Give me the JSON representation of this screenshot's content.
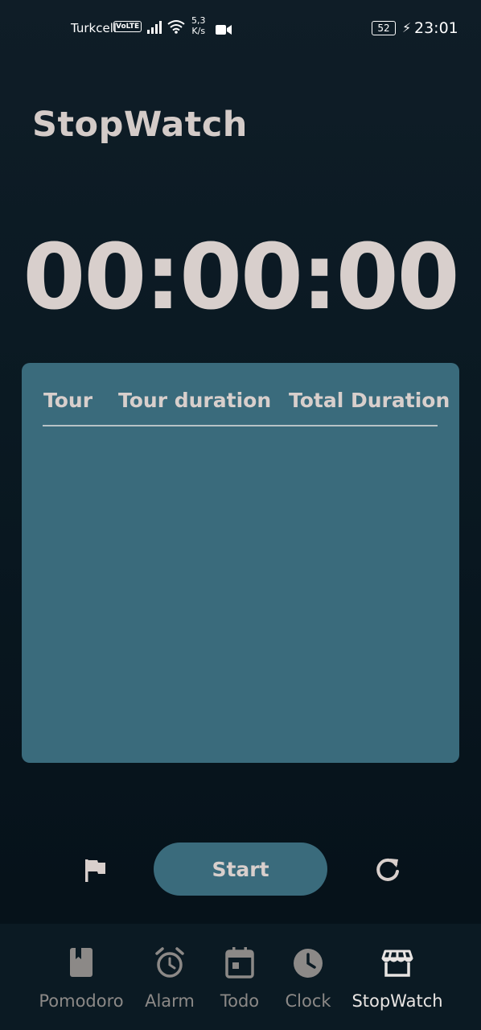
{
  "status_bar": {
    "carrier": "Turkcell",
    "volte": "VoLTE",
    "speed_value": "5,3",
    "speed_unit": "K/s",
    "battery": "52",
    "time": "23:01"
  },
  "header": {
    "title": "StopWatch"
  },
  "timer": {
    "display": "00:00:00"
  },
  "tour_table": {
    "columns": [
      "Tour",
      "Tour duration",
      "Total Duration"
    ],
    "rows": []
  },
  "controls": {
    "start_label": "Start",
    "flag_icon": "flag-icon",
    "reset_icon": "refresh-icon"
  },
  "bottom_nav": {
    "items": [
      {
        "label": "Pomodoro",
        "icon": "book-icon"
      },
      {
        "label": "Alarm",
        "icon": "alarm-clock-icon"
      },
      {
        "label": "Todo",
        "icon": "calendar-icon"
      },
      {
        "label": "Clock",
        "icon": "clock-icon"
      },
      {
        "label": "StopWatch",
        "icon": "store-icon"
      }
    ],
    "active": "StopWatch"
  },
  "colors": {
    "background": "#07121b",
    "card": "#3a6b7c",
    "text": "#d8cfcc",
    "nav_bg": "#0b1a23",
    "nav_inactive": "#8c8987"
  }
}
